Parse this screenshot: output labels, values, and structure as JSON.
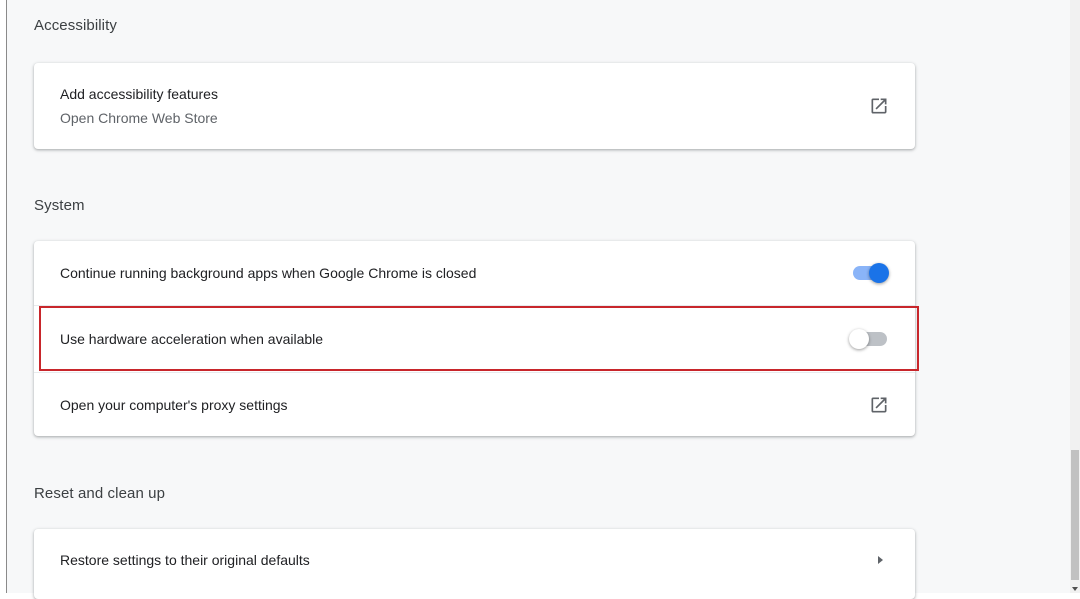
{
  "accessibility": {
    "title": "Accessibility",
    "add_features": {
      "label": "Add accessibility features",
      "sublabel": "Open Chrome Web Store",
      "icon": "external-link-icon"
    }
  },
  "system": {
    "title": "System",
    "background_apps": {
      "label": "Continue running background apps when Google Chrome is closed",
      "enabled": true
    },
    "hardware_acceleration": {
      "label": "Use hardware acceleration when available",
      "enabled": false
    },
    "proxy": {
      "label": "Open your computer's proxy settings",
      "icon": "external-link-icon"
    }
  },
  "reset": {
    "title": "Reset and clean up",
    "restore": {
      "label": "Restore settings to their original defaults",
      "icon": "arrow-right-icon"
    }
  },
  "colors": {
    "toggle_on": "#1a73e8",
    "toggle_on_track": "#8ab4f8",
    "toggle_off_track": "#bdc1c6",
    "highlight": "#c8262b"
  }
}
